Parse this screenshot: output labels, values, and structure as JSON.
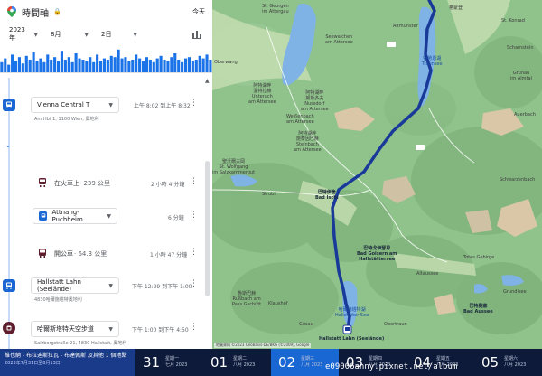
{
  "header": {
    "title": "時間軸",
    "today_label": "今天"
  },
  "date_selector": {
    "year": "2023年",
    "month": "8月",
    "day": "2日"
  },
  "histogram": {
    "color": "#1a73e8",
    "values": [
      0.4,
      0.55,
      0.3,
      0.7,
      0.45,
      0.6,
      0.35,
      0.65,
      0.5,
      0.8,
      0.45,
      0.55,
      0.4,
      0.7,
      0.5,
      0.6,
      0.45,
      0.85,
      0.5,
      0.6,
      0.4,
      0.75,
      0.55,
      0.5,
      0.45,
      0.6,
      0.4,
      0.7,
      0.45,
      0.55,
      0.5,
      0.65,
      0.6,
      0.9,
      0.55,
      0.6,
      0.45,
      0.5,
      0.7,
      0.55,
      0.45,
      0.6,
      0.5,
      0.4,
      0.55,
      0.65,
      0.5,
      0.45,
      0.6,
      0.75,
      0.5,
      0.4,
      0.55,
      0.6,
      0.45,
      0.5,
      0.65,
      0.55,
      0.7,
      0.5
    ]
  },
  "timeline": {
    "entries": [
      {
        "type": "place",
        "name": "Vienna Central T",
        "address": "Am Hbf 1, 1100 Wien, 奧地利",
        "time": "上午 8:02 到上午 8:32"
      },
      {
        "type": "activity",
        "mode": "在火車上",
        "distance": "· 239 公里",
        "duration": "2 小時 4 分鐘"
      },
      {
        "type": "place",
        "name": "Attnang-Puchheim",
        "time": "6 分鐘"
      },
      {
        "type": "activity",
        "mode": "開公車",
        "distance": "· 64.3 公里",
        "duration": "1 小時 47 分鐘"
      },
      {
        "type": "place",
        "name": "Hallstatt Lahn (Seelände)",
        "address": "4830哈爾施塔特奧地利",
        "time": "下午 12:29 到下午 1:00"
      },
      {
        "type": "place",
        "name": "哈爾斯塔特天空步道",
        "address": "Salzbergstraße 21, 4830 Hallstatt, 奧地利",
        "time": "下午 1:00 到下午 4:50"
      }
    ]
  },
  "map": {
    "labels": {
      "st_georgen": "St. Georgen\nim Attergau",
      "seewalchen": "Seewalchen\nam Attersee",
      "oberwang": "Oberwang",
      "unterach": "阿特湖畔\n溫特拉赫\nUnterach\nam Attersee",
      "weissenbach": "Weißenbach\nam Attersee",
      "nussdorf": "阿特湖畔\n努斯多夫\nNussdorf\nam Attersee",
      "steinbach": "阿特湖畔\n施泰因巴赫\nSteinbach\nam Attersee",
      "st_wolfgang": "聖沃爾夫岡\nSt. Wolfgang\nim Salzkammergut",
      "strobl": "Strobl",
      "bad_ischl": "巴特伊舍\nBad Ischl",
      "traunsee": "特勞恩湖\nTraunsee",
      "gmunden": "格蒙登",
      "altmunster": "Altmünster",
      "st_konrad": "St. Konrad",
      "scharnstein": "Scharnstein",
      "grunau": "Grünau\nim Almtal",
      "auerbach": "Auerbach",
      "schwarzenbach": "Schwarzenbach",
      "bad_goisern": "巴特戈伊瑟恩\nBad Goisern am\nHallstättersee",
      "hallstatt_lake": "哈爾施塔特湖\nHallstätter See",
      "gosau": "Gosau",
      "russbach": "魯斯巴赫\nRußbach am\nPass Gschütt",
      "obertraun": "Obertraun",
      "totes_gebirge": "Totes Gebirge",
      "altaussee": "Altaussee",
      "bad_aussee": "巴特奧塞\nBad Aussee",
      "grundlsee": "Grundlsee",
      "hallstatt": "Hallstatt Lahn (Seelände)",
      "klauss": "Klaushof"
    },
    "attribution": "地圖資料 ©2023 GeoBasis-DE/BKG (©2009), Google"
  },
  "bottom_strip": {
    "info_line1": "維也納 - 布拉迪斯拉瓦 - 布達佩斯 及其他 1 個地點",
    "info_line2": "2023年7月31日至8月13日",
    "days": [
      {
        "num": "31",
        "weekday": "星期一",
        "month": "七月 2023"
      },
      {
        "num": "01",
        "weekday": "星期二",
        "month": "八月 2023"
      },
      {
        "num": "02",
        "weekday": "星期三",
        "month": "八月 2023",
        "active": true
      },
      {
        "num": "03",
        "weekday": "星期四",
        "month": "八月 2023"
      },
      {
        "num": "04",
        "weekday": "星期五",
        "month": "八月 2023"
      },
      {
        "num": "05",
        "weekday": "星期六",
        "month": "八月 2023"
      }
    ],
    "watermark": "e09006anny.pixnet.net/album"
  }
}
